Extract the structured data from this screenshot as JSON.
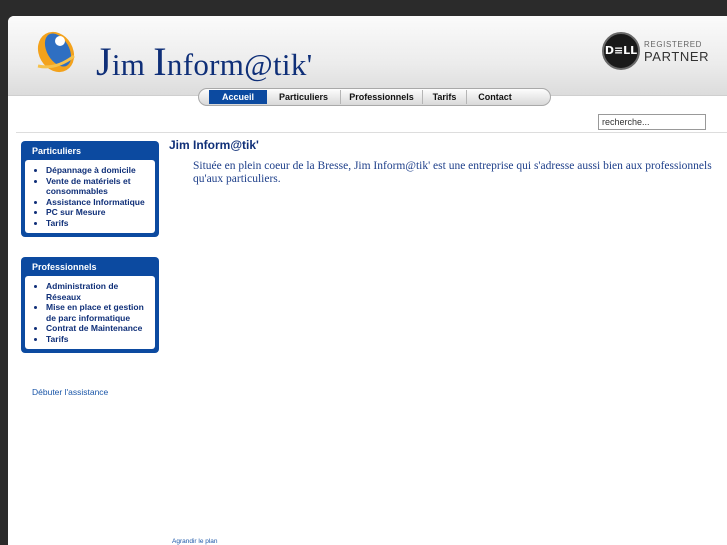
{
  "header": {
    "brand_first_letter": "J",
    "brand_first_rest": "im ",
    "brand_second_letter": "I",
    "brand_second_rest": "nform@tik'",
    "partner_logo_text": "D≡LL",
    "partner_registered": "REGISTERED",
    "partner_label": "PARTNER"
  },
  "nav": {
    "items": [
      {
        "label": "Accueil",
        "active": true
      },
      {
        "label": "Particuliers",
        "active": false
      },
      {
        "label": "Professionnels",
        "active": false
      },
      {
        "label": "Tarifs",
        "active": false
      },
      {
        "label": "Contact",
        "active": false
      }
    ]
  },
  "search": {
    "placeholder": "recherche..."
  },
  "sidebar": {
    "particuliers": {
      "title": "Particuliers",
      "items": [
        "Dépannage à domicile",
        "Vente de matériels et consommables",
        "Assistance Informatique",
        "PC sur Mesure",
        "Tarifs"
      ]
    },
    "professionnels": {
      "title": "Professionnels",
      "items": [
        "Administration de Réseaux",
        "Mise en place et gestion de parc informatique",
        "Contrat de Maintenance",
        "Tarifs"
      ]
    },
    "assist_link": "Débuter l'assistance"
  },
  "main": {
    "title": "Jim Inform@tik'",
    "intro": "Située en plein coeur de la Bresse, Jim Inform@tik' est une entreprise qui s'adresse aussi bien aux professionnels qu'aux particuliers.",
    "map_link": "Agrandir le plan"
  },
  "colors": {
    "brand_blue": "#0c4aa0",
    "text_navy": "#0f2f78",
    "background": "#2b2b2b"
  }
}
